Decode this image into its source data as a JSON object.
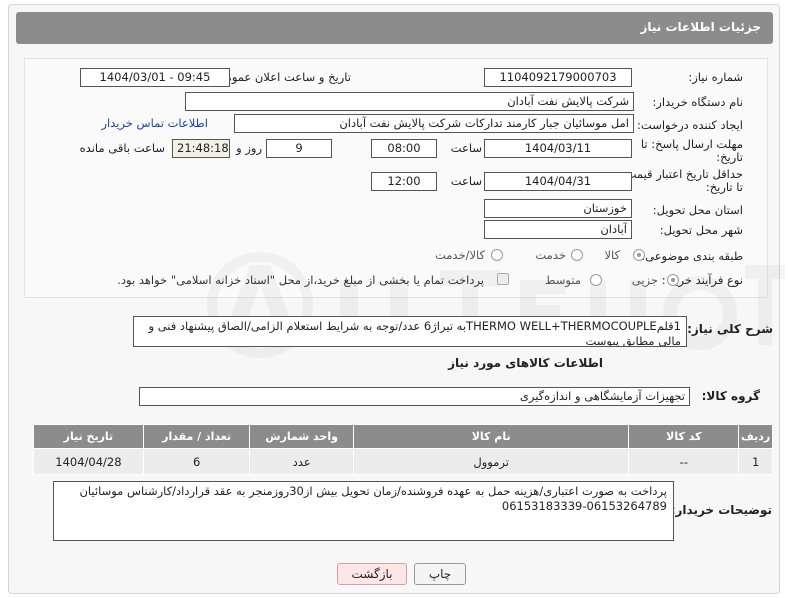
{
  "header": {
    "title": "جزئیات اطلاعات نیاز"
  },
  "form": {
    "need_number": {
      "label": "شماره نیاز:",
      "value": "1104092179000703"
    },
    "announce_datetime": {
      "label": "تاریخ و ساعت اعلان عمومی:",
      "value": "1404/03/01 - 09:45"
    },
    "buyer_org": {
      "label": "نام دستگاه خریدار:",
      "value": "شرکت پالایش نفت آبادان"
    },
    "requester": {
      "label": "ایجاد کننده درخواست:",
      "value": "امل موسائیان جبار کارمند تدارکات شرکت پالایش نفت آبادان"
    },
    "buyer_contact_link": "اطلاعات تماس خریدار",
    "reply_deadline": {
      "label_line1": "مهلت ارسال پاسخ: تا",
      "label_line2": "تاریخ:",
      "date": "1404/03/11",
      "time_label": "ساعت",
      "time": "08:00",
      "days": "9",
      "days_label": "روز و",
      "remaining": "21:48:18",
      "remaining_label": "ساعت باقی مانده"
    },
    "price_validity": {
      "label_line1": "حداقل تاریخ اعتبار قیمت:",
      "label_line2": "تا تاریخ:",
      "date": "1404/04/31",
      "time_label": "ساعت",
      "time": "12:00"
    },
    "delivery_province": {
      "label": "استان محل تحویل:",
      "value": "خوزستان"
    },
    "delivery_city": {
      "label": "شهر محل تحویل:",
      "value": "آبادان"
    },
    "category": {
      "label": "طبقه بندی موضوعی:",
      "options": [
        "کالا",
        "خدمت",
        "کالا/خدمت"
      ],
      "selected": "کالا"
    },
    "purchase_process": {
      "label": "نوع فرآیند خرید :",
      "options": [
        "جزیی",
        "متوسط"
      ],
      "selected": "جزیی",
      "payment_note": "پرداخت تمام یا بخشی از مبلغ خرید،از محل \"اسناد خزانه اسلامی\" خواهد بود."
    }
  },
  "description": {
    "label": "شرح کلی نیاز:",
    "value": "1قلمTHERMO WELL+THERMOCOUPLEبه تیراژ6 عدد/توجه به شرایط استعلام الزامی/الصاق پیشنهاد فنی و مالی مطابق پیوست"
  },
  "goods_section": {
    "title": "اطلاعات کالاهای مورد نیاز",
    "group_label": "گروه کالا:",
    "group_value": "تجهیزات آزمایشگاهی و اندازه‌گیری"
  },
  "table": {
    "headers": [
      "ردیف",
      "کد کالا",
      "نام کالا",
      "واحد شمارش",
      "تعداد / مقدار",
      "تاریخ نیاز"
    ],
    "rows": [
      [
        "1",
        "--",
        "ترموول",
        "عدد",
        "6",
        "1404/04/28"
      ]
    ]
  },
  "buyer_notes": {
    "label": "توضیحات خریدار:",
    "value": "پرداخت به صورت اعتباری/هزینه حمل به عهده فروشنده/زمان تحویل بیش از30روزمنجر به عقد قرارداد/کارشناس موسائیان 06153264789-06153183339"
  },
  "buttons": {
    "print": "چاپ",
    "back": "بازگشت"
  },
  "colors": {
    "header_bg": "#8c8c8c",
    "link": "#1a44a8",
    "back_button_bg": "#fde6e6"
  }
}
